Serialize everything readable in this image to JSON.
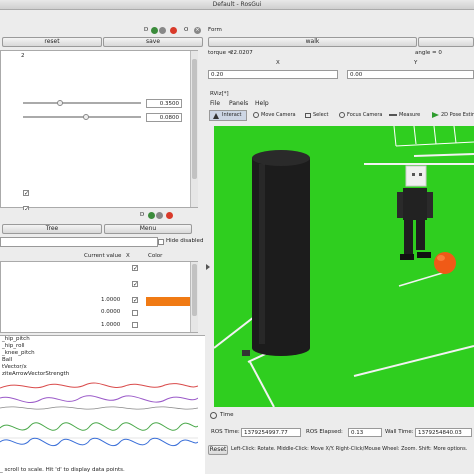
{
  "window": {
    "title": "Default - RosGui"
  },
  "left_top": {
    "dock_label": "D",
    "reset_label": "reset",
    "save_label": "save",
    "list_index": "2",
    "slider1_value": "0.3500",
    "slider2_value": "0.0800"
  },
  "left_mid": {
    "dock_label": "D",
    "tree_label": "Tree",
    "menu_label": "Menu",
    "hide_disabled_label": "Hide disabled",
    "col_current_value": "Current value",
    "col_x": "X",
    "col_color": "Color",
    "row_value_1": "1.0000",
    "row_value_2": "0.0000",
    "row_value_3": "1.0000",
    "color_swatch": "#f07a14"
  },
  "plot": {
    "labels": [
      "_hip_pitch",
      "_hip_roll",
      "_knee_pitch",
      "Ball",
      "tVector/x",
      "ziteArrowVectorStrength"
    ],
    "status": "_ scroll to scale. Hit 'd' to display data points.",
    "series_colors": [
      "#d94b4b",
      "#9a59c8",
      "#4aa84a",
      "#3a6fd8"
    ]
  },
  "form": {
    "label": "Form",
    "walk_label": "walk",
    "torque_label": "torque =",
    "torque_value": "22.0207",
    "angle_label": "angle = 0",
    "x_label": "X",
    "y_label": "Y",
    "input_left": "0.20",
    "input_right": "0.00"
  },
  "rviz": {
    "title": "RViz[*]",
    "menu": [
      "File",
      "Panels",
      "Help"
    ],
    "tools": [
      "Interact",
      "Move Camera",
      "Select",
      "Focus Camera",
      "Measure",
      "2D Pose Estim"
    ],
    "scene_colors": {
      "field": "#2fce1f",
      "cylinder": "#1c1c1c",
      "ball": "#f05a17",
      "robot": "#222222",
      "line": "#f2f2f2"
    }
  },
  "time_panel": {
    "label": "Time",
    "ros_time_label": "ROS Time:",
    "ros_time_value": "1379254997.77",
    "ros_elapsed_label": "ROS Elapsed:",
    "ros_elapsed_value": "0.13",
    "wall_time_label": "Wall Time:",
    "wall_time_value": "1379254840.03"
  },
  "status_bar": {
    "reset_label": "Reset",
    "hint": "Left-Click: Rotate. Middle-Click: Move X/Y. Right-Click/Mouse Wheel: Zoom. Shift: More options."
  }
}
